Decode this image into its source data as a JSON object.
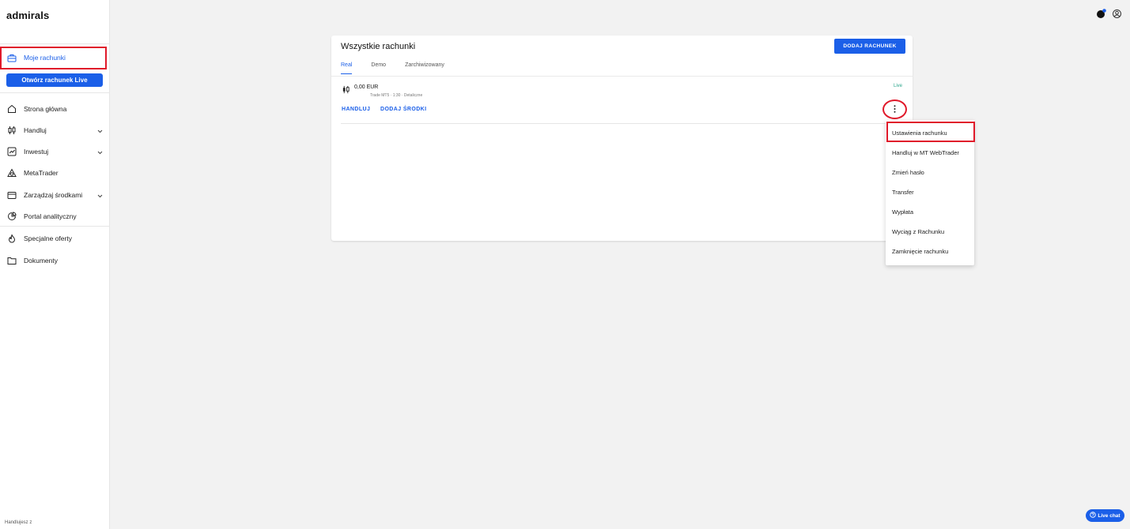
{
  "brand": {
    "logo": "admirals"
  },
  "sidebar": {
    "primary": {
      "label": "Moje rachunki",
      "icon": "briefcase-icon"
    },
    "open_live_button": "Otwórz rachunek Live",
    "items": [
      {
        "label": "Strona główna",
        "icon": "home-icon"
      },
      {
        "label": "Handluj",
        "icon": "candles-icon"
      },
      {
        "label": "Inwestuj",
        "icon": "trend-icon"
      },
      {
        "label": "MetaTrader",
        "icon": "metatrader-icon"
      },
      {
        "label": "Zarządzaj środkami",
        "icon": "wallet-icon"
      },
      {
        "label": "Portal analityczny",
        "icon": "pie-chart-icon"
      },
      {
        "label": "Specjalne oferty",
        "icon": "flame-icon"
      },
      {
        "label": "Dokumenty",
        "icon": "folder-icon"
      }
    ],
    "footer_note": "Handlujesz z"
  },
  "header": {
    "icons": [
      "notifications-icon",
      "user-icon"
    ]
  },
  "card": {
    "title": "Wszystkie rachunki",
    "add_button": "DODAJ RACHUNEK",
    "tabs": [
      {
        "label": "Real",
        "active": true
      },
      {
        "label": "Demo",
        "active": false
      },
      {
        "label": "Zarchiwizowany",
        "active": false
      }
    ],
    "account": {
      "balance": "0,00 EUR",
      "meta": "Trade MT5 · 1:30 · Detaliczne",
      "status": "Live",
      "actions": [
        "HANDLUJ",
        "DODAJ ŚRODKI"
      ]
    }
  },
  "menu": {
    "items": [
      "Ustawienia rachunku",
      "Handluj w MT WebTrader",
      "Zmień hasło",
      "Transfer",
      "Wypłata",
      "Wyciąg z Rachunku",
      "Zamknięcie rachunku"
    ]
  },
  "live_chat": {
    "label": "Live chat"
  },
  "colors": {
    "accent": "#1b5fe8",
    "highlight": "#e0192a",
    "live_status": "#2aa58b"
  }
}
